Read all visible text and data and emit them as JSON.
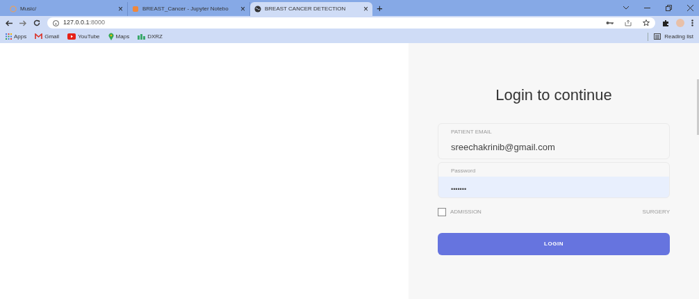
{
  "tabs": [
    {
      "label": "Music/",
      "selected": false
    },
    {
      "label": "BREAST_Cancer - Jupyter Notebo",
      "selected": false
    },
    {
      "label": "BREAST CANCER DETECTION",
      "selected": true
    }
  ],
  "close_glyph": "×",
  "new_tab_glyph": "+",
  "address": {
    "host": "127.0.0.1",
    "port": ":8000"
  },
  "bookmarks": [
    {
      "label": "Apps"
    },
    {
      "label": "Gmail"
    },
    {
      "label": "YouTube"
    },
    {
      "label": "Maps"
    },
    {
      "label": "DXRZ"
    }
  ],
  "reading_list": "Reading list",
  "login": {
    "title": "Login to continue",
    "fields": [
      {
        "label": "PATIENT EMAIL",
        "value": "sreechakrinib@gmail.com",
        "autofilled": false
      },
      {
        "label": "Password",
        "value": "•••••••",
        "autofilled": true
      }
    ],
    "checkbox": {
      "label": "ADMISSION",
      "checked": false
    },
    "link": "SURGERY",
    "button": "LOGIN"
  }
}
